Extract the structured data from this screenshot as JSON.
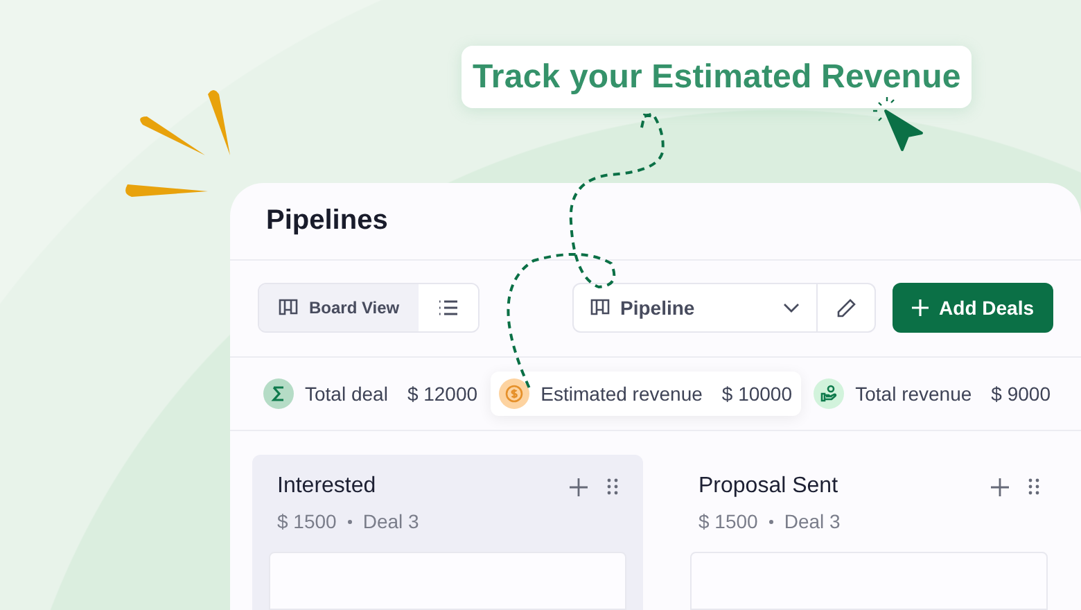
{
  "callout": {
    "text": "Track your Estimated Revenue"
  },
  "panel": {
    "title": "Pipelines"
  },
  "views": [
    {
      "label": "Board View",
      "kind": "board",
      "selected": true
    },
    {
      "kind": "list",
      "selected": false
    }
  ],
  "pipeline_select": {
    "value": "Pipeline"
  },
  "add_button": {
    "label": "Add Deals"
  },
  "stats": [
    {
      "label": "Total deal",
      "value": "$ 12000",
      "kind": "sigma",
      "color": "#b5dcc6",
      "highlighted": false
    },
    {
      "label": "Estimated revenue",
      "value": "$ 10000",
      "kind": "coin",
      "color": "#fdd3a0",
      "highlighted": true
    },
    {
      "label": "Total revenue",
      "value": "$ 9000",
      "kind": "hand",
      "color": "#d2f3dc",
      "highlighted": false
    }
  ],
  "columns": [
    {
      "title": "Interested",
      "amount": "$ 1500",
      "deals": "Deal 3",
      "highlighted": true
    },
    {
      "title": "Proposal Sent",
      "amount": "$ 1500",
      "deals": "Deal 3",
      "highlighted": false
    }
  ]
}
